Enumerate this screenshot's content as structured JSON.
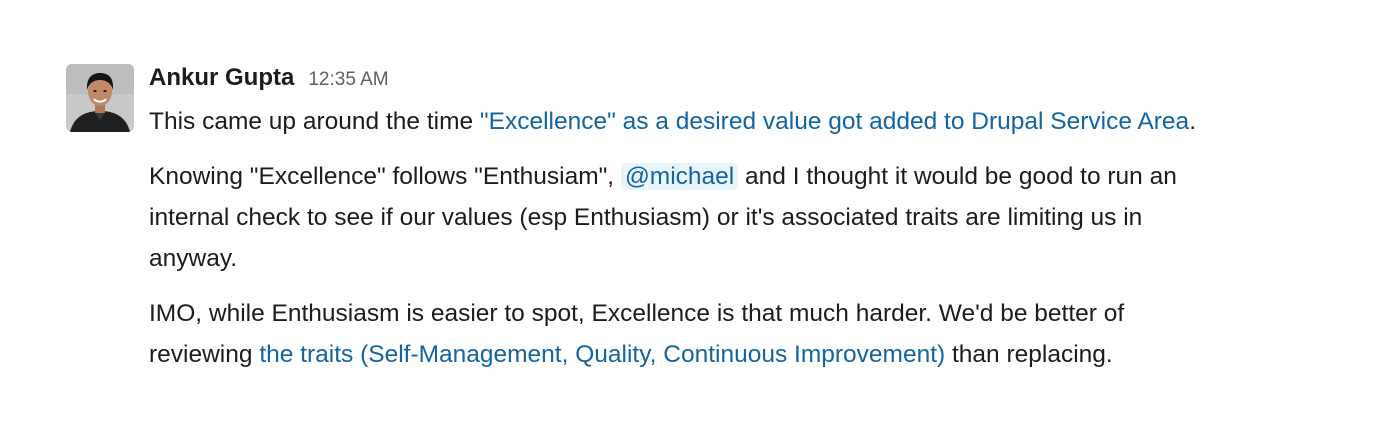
{
  "message": {
    "author": "Ankur Gupta",
    "timestamp": "12:35 AM",
    "avatar_icon": "user-avatar-photo",
    "colors": {
      "text": "#1d1c1d",
      "link": "#1264a3",
      "mention_bg": "#e8f5fa",
      "timestamp": "#616061"
    },
    "paragraphs": [
      {
        "text_before": "This came up around the time ",
        "link": "\"Excellence\" as a desired value got added to Drupal Service Area",
        "text_after": "."
      },
      {
        "line1_before": "Knowing \"Excellence\" follows \"Enthusiam\", ",
        "mention": "@michael",
        "line1_after": " and I thought it would be good to run an",
        "line2": "internal check to see if our values (esp Enthusiasm) or it's associated traits are limiting us in",
        "line3": "anyway."
      },
      {
        "line1": "IMO, while Enthusiasm is easier to spot, Excellence is that much harder. We'd be better of",
        "line2_before": "reviewing ",
        "link": "the traits (Self-Management, Quality, Continuous Improvement)",
        "line2_after": " than replacing."
      }
    ]
  }
}
